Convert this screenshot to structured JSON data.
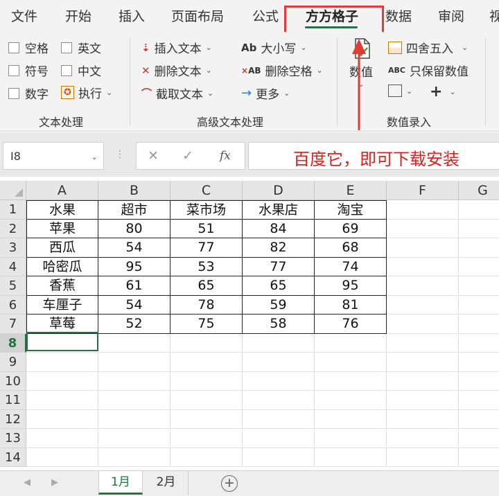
{
  "tabs": [
    "文件",
    "开始",
    "插入",
    "页面布局",
    "公式",
    "方方格子",
    "数据",
    "审阅",
    "视"
  ],
  "active_tab": "方方格子",
  "ribbon": {
    "group_text": {
      "label": "文本处理",
      "checkboxes": [
        "空格",
        "英文",
        "符号",
        "中文",
        "数字"
      ],
      "execute": "执行"
    },
    "group_advanced": {
      "label": "高级文本处理",
      "insert_text": "插入文本",
      "delete_text": "删除文本",
      "extract_text": "截取文本",
      "case": "大小写",
      "delete_spaces": "删除空格",
      "more": "更多",
      "case_icon": "Ab",
      "delete_spaces_icon": "AB"
    },
    "group_number": {
      "label": "数值录入",
      "value_big": "数值",
      "round": "四舍五入",
      "keep_values": "只保留数值",
      "abc_icon": "ABC"
    }
  },
  "formula_bar": {
    "name_box": "I8",
    "fx": "fx",
    "content": "百度它，即可下载安装"
  },
  "columns": [
    "A",
    "B",
    "C",
    "D",
    "E",
    "F",
    "G"
  ],
  "rows": [
    "1",
    "2",
    "3",
    "4",
    "5",
    "6",
    "7",
    "8",
    "9",
    "10",
    "11",
    "12",
    "13",
    "14"
  ],
  "table": {
    "header": [
      "水果",
      "超市",
      "菜市场",
      "水果店",
      "淘宝"
    ],
    "body": [
      [
        "苹果",
        "80",
        "51",
        "84",
        "69"
      ],
      [
        "西瓜",
        "54",
        "77",
        "82",
        "68"
      ],
      [
        "哈密瓜",
        "95",
        "53",
        "77",
        "74"
      ],
      [
        "香蕉",
        "61",
        "65",
        "65",
        "95"
      ],
      [
        "车厘子",
        "54",
        "78",
        "59",
        "81"
      ],
      [
        "草莓",
        "52",
        "75",
        "58",
        "76"
      ]
    ]
  },
  "sheets": [
    "1月",
    "2月"
  ],
  "active_sheet": "1月",
  "colors": {
    "accent": "#217346",
    "annotation": "#e53935"
  }
}
